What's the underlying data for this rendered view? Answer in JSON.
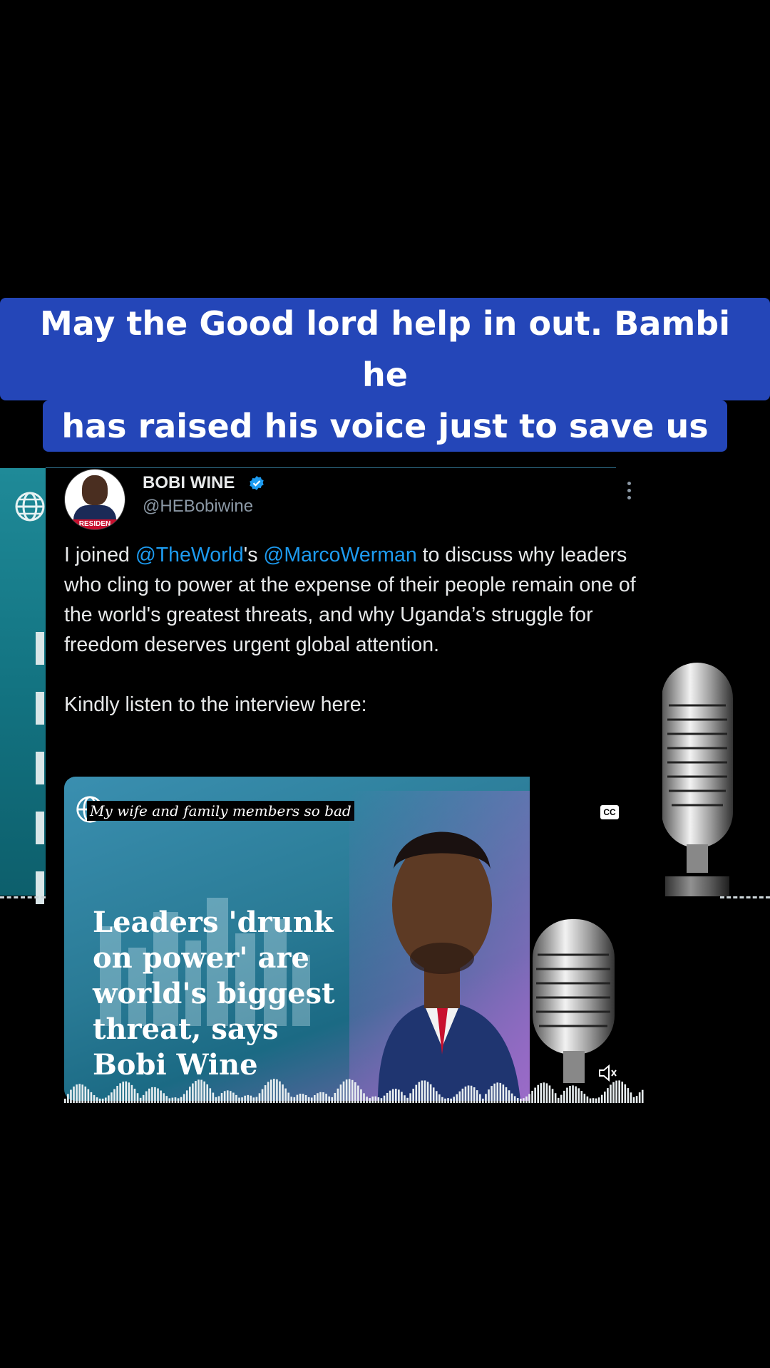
{
  "caption": {
    "line1": "May the Good lord help in out. Bambi he",
    "line2": "has raised his voice just to save us"
  },
  "tweet": {
    "name": "BOBI WINE",
    "handle": "@HEBobiwine",
    "avatar_band": "RESIDEN",
    "text_parts": {
      "p1_a": "I joined ",
      "mention1": "@TheWorld",
      "p1_b": "'s ",
      "mention2": "@MarcoWerman",
      "p1_c": " to discuss why leaders who cling to power at the expense of their people remain one of the world's greatest threats, and why Uganda’s struggle for freedom deserves urgent global attention.",
      "p2": "Kindly listen to the interview here:"
    }
  },
  "media": {
    "subtitle": "My wife and family members so bad",
    "headline_lines": [
      "Leaders 'drunk",
      "on power' are",
      "world's biggest",
      "threat, says",
      "Bobi Wine"
    ],
    "cc_label": "CC"
  },
  "colors": {
    "caption_bg": "#2446b8",
    "mention": "#1d9bf0",
    "verified": "#1d9bf0"
  },
  "icons": [
    "globe-icon",
    "verified-badge-icon",
    "more-options-icon",
    "microphone-icon",
    "mute-icon",
    "cc-icon"
  ]
}
